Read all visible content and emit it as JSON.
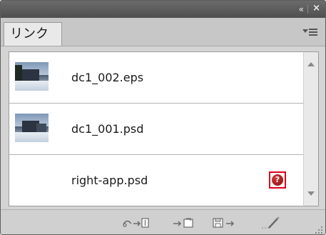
{
  "panel": {
    "tab_label": "リンク",
    "title_buttons": {
      "collapse": "«",
      "close": "×"
    }
  },
  "links": [
    {
      "name": "dc1_002.eps",
      "has_thumbnail": true,
      "status": ""
    },
    {
      "name": "dc1_001.psd",
      "has_thumbnail": true,
      "status": ""
    },
    {
      "name": "right-app.psd",
      "has_thumbnail": false,
      "status": "?"
    }
  ],
  "icons": {
    "status_missing": "missing-link-icon",
    "relink": "relink-icon",
    "go_to_link": "go-to-link-icon",
    "update_link": "update-link-icon",
    "edit_original": "edit-original-icon",
    "panel_menu": "panel-menu-icon"
  },
  "colors": {
    "missing_highlight": "#e0001b",
    "missing_badge": "#9a1010"
  }
}
